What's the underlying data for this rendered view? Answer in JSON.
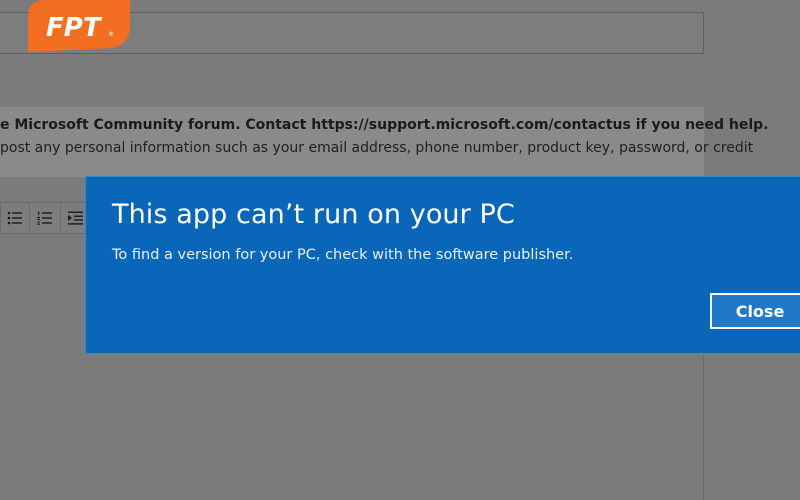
{
  "background": {
    "notice_line1": "e Microsoft Community forum. Contact https://support.microsoft.com/contactus if you need help.",
    "notice_line2": "post any personal information such as your email address, phone number, product key, password, or credit"
  },
  "toolbar": {
    "items": [
      {
        "icon": "bulleted-list-icon"
      },
      {
        "icon": "numbered-list-icon"
      },
      {
        "icon": "indent-icon"
      }
    ]
  },
  "dialog": {
    "title": "This app can’t run on your PC",
    "message": "To find a version for your PC, check with the software publisher.",
    "close_label": "Close"
  },
  "watermark": {
    "text": "FPT",
    "color": "#f26f21"
  },
  "colors": {
    "dialog_bg": "#0a66b8",
    "overlay": "#7b7b7b"
  }
}
